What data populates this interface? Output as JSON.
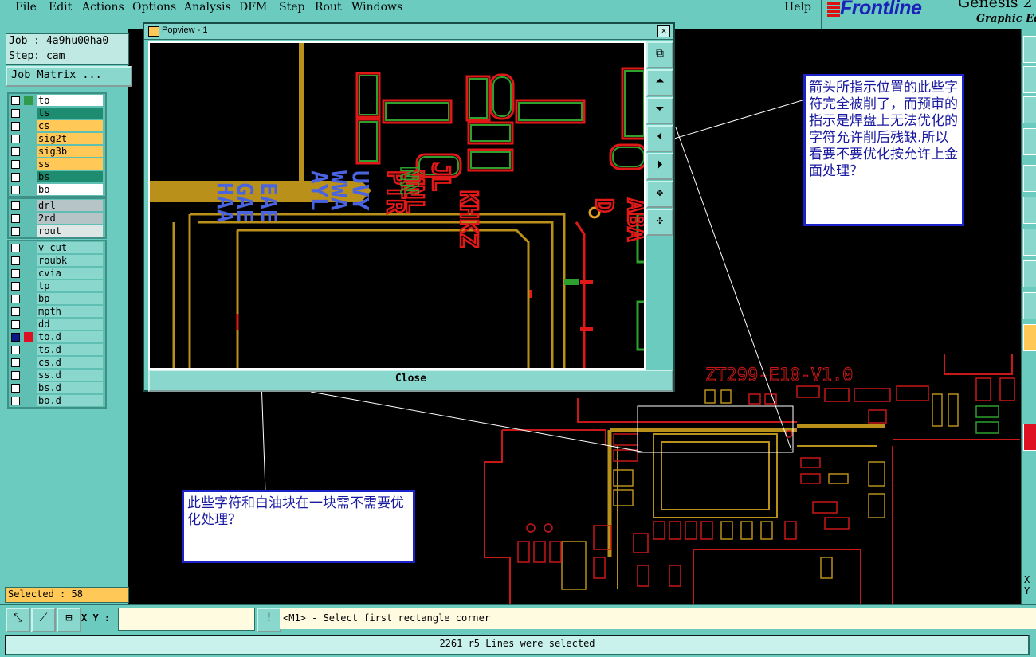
{
  "menubar": {
    "items": [
      "File",
      "Edit",
      "Actions",
      "Options",
      "Analysis",
      "DFM",
      "Step",
      "Rout",
      "Windows"
    ],
    "help": "Help"
  },
  "logo": {
    "brand": "Frontline",
    "title": "Genesis 2",
    "subtitle": "Graphic Edit"
  },
  "leftpanel": {
    "job": "Job : 4a9hu00ha0",
    "step": "Step: cam",
    "job_matrix_button": "Job Matrix ...",
    "selected": "Selected : 58"
  },
  "layers": {
    "board": [
      {
        "name": "to",
        "color": "#ffffff",
        "mark": "#2e9a4a"
      },
      {
        "name": "ts",
        "color": "#1e8c70",
        "mark": ""
      },
      {
        "name": "cs",
        "color": "#ffc857",
        "mark": ""
      },
      {
        "name": "sig2t",
        "color": "#ffc857",
        "mark": ""
      },
      {
        "name": "sig3b",
        "color": "#ffc857",
        "mark": ""
      },
      {
        "name": "ss",
        "color": "#ffc857",
        "mark": ""
      },
      {
        "name": "bs",
        "color": "#1e8c70",
        "mark": ""
      },
      {
        "name": "bo",
        "color": "#ffffff",
        "mark": ""
      }
    ],
    "drill": [
      {
        "name": "drl",
        "color": "#b7c4c7",
        "mark": ""
      },
      {
        "name": "2rd",
        "color": "#b7c4c7",
        "mark": ""
      },
      {
        "name": "rout",
        "color": "#dfe6e6",
        "mark": ""
      }
    ],
    "misc": [
      {
        "name": "v-cut",
        "color": "#8ad8cd",
        "mark": ""
      },
      {
        "name": "roubk",
        "color": "#8ad8cd",
        "mark": ""
      },
      {
        "name": "cvia",
        "color": "#8ad8cd",
        "mark": ""
      },
      {
        "name": "tp",
        "color": "#8ad8cd",
        "mark": ""
      },
      {
        "name": "bp",
        "color": "#8ad8cd",
        "mark": ""
      },
      {
        "name": "mpth",
        "color": "#8ad8cd",
        "mark": ""
      },
      {
        "name": "dd",
        "color": "#8ad8cd",
        "mark": ""
      },
      {
        "name": "to.d",
        "color": "#8ad8cd",
        "mark": "#d12"
      },
      {
        "name": "ts.d",
        "color": "#8ad8cd",
        "mark": ""
      },
      {
        "name": "cs.d",
        "color": "#8ad8cd",
        "mark": ""
      },
      {
        "name": "ss.d",
        "color": "#8ad8cd",
        "mark": ""
      },
      {
        "name": "bs.d",
        "color": "#8ad8cd",
        "mark": ""
      },
      {
        "name": "bo.d",
        "color": "#8ad8cd",
        "mark": ""
      }
    ]
  },
  "popview": {
    "title": "Popview - 1",
    "close_x": "×",
    "close_button": "Close",
    "board_text": "ZT299-E10-V1.0"
  },
  "callouts": {
    "right": "箭头所指示位置的此些字符完全被削了，而预审的指示是焊盘上无法优化的字符允许削后残缺.所以看要不要优化按允许上金面处理？",
    "bottom": "此些字符和白油块在一块需不需要优化处理？"
  },
  "bottombar": {
    "xy_label": "X Y :",
    "info_button": "!",
    "prompt": "<M1> - Select first rectangle corner"
  },
  "right_panel": {
    "xy_label": "X\nY"
  },
  "status": "2261 r5 Lines were selected",
  "colors": {
    "panel": "#6ccbbf",
    "callout_border": "#1a22c8",
    "trace_gold": "#b8901a",
    "outline_red": "#e01818",
    "outline_green": "#2ea02e",
    "silk_blue": "#4a63e0"
  }
}
